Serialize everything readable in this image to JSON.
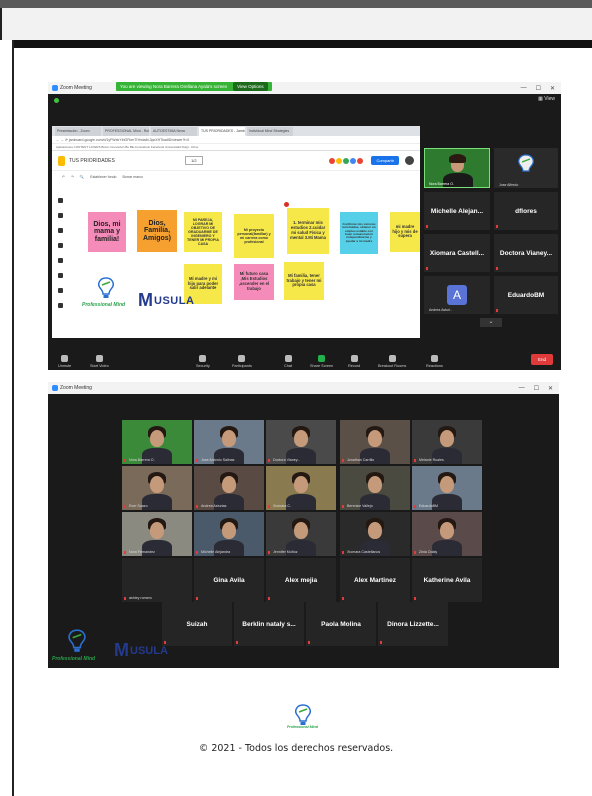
{
  "window1": {
    "title": "Zoom Meeting",
    "banner": "You are viewing Nora Barrera Orellana Ayala's screen",
    "view_options": "View Options",
    "view_label": "View",
    "browser": {
      "tabs": [
        "Presentación - Zoom",
        "PROFESSIONAL Mind - Ruta",
        "AUTOESTIMA Nena",
        "TUS PRIORIDADES - Jamboard",
        "Individual Mind Strategies"
      ],
      "url": "jamboard.google.com/d/1yFWxtrYbiGFbmTiYfwlaM-3pcXHTkadlD/viewer?f=0",
      "bookmarks": "Aplicaciones  CONTENT LAYERS  Boton Innovación  Bu  BE-Consultorio  Facebook  Universidad Rutgr..  Drive"
    },
    "jamboard": {
      "title": "TUS PRIORIDADES",
      "page_indicator": "1/2",
      "share_label": "Compartir",
      "tools": [
        "Establecer fondo",
        "Borrar marco"
      ]
    },
    "notes": [
      {
        "text": "Dios, mi mama y familia!",
        "color": "#f58bb8"
      },
      {
        "text": "Dios, Familia, Amigos)",
        "color": "#f6a030"
      },
      {
        "text": "MI PAREJA, LOGRAR MI OBJETIVO DE GRADUARME DE INGENIERO Y TENER MI PROPIA CASA",
        "color": "#f7e84a"
      },
      {
        "text": "Mi proyecto personal(familiar) y mi carrera como profesional",
        "color": "#f7e84a"
      },
      {
        "text": "1. terminar mis estudios 2.cuidar mi salud Física y mental 3.Mi Mama",
        "color": "#f7e84a"
      },
      {
        "text": "Confirmar mis carreras terminadas, obtener un empleo estable con buen remuneración independizarme y ayudar a mi madre",
        "color": "#56d0e8"
      },
      {
        "text": "mi madre hijo y mis de supera",
        "color": "#f7e84a"
      },
      {
        "text": "Mi madre y mi hijo para poder salir adelante",
        "color": "#f7e84a"
      },
      {
        "text": "Mi futuro casa ,Mis Estudios ,ascender en el trabajo",
        "color": "#f58bb8"
      },
      {
        "text": "Mi familia, tener trabajo y tener mi propia casa",
        "color": "#f7e84a"
      }
    ],
    "brand": {
      "tagline": "Professional Mind",
      "partner": "USULA"
    },
    "participants": [
      {
        "name": "Nora Barrera O.",
        "tile": "video"
      },
      {
        "name": "Jose Alfredo",
        "tile": "video"
      },
      {
        "name": "Michelle Alejan...",
        "tile": "name"
      },
      {
        "name": "dflores",
        "tile": "name"
      },
      {
        "name": "Xiomara Castell...",
        "tile": "name"
      },
      {
        "name": "Doctora Vianey...",
        "tile": "name"
      },
      {
        "name": "Andrea Asturi..",
        "tile": "avatar",
        "initial": "A"
      },
      {
        "name": "EduardoBM",
        "tile": "name"
      }
    ],
    "toolbar": [
      {
        "label": "Unmute",
        "icon": "mic-muted-icon"
      },
      {
        "label": "Start Video",
        "icon": "video-off-icon"
      },
      {
        "label": "Security",
        "icon": "shield-icon"
      },
      {
        "label": "Participants",
        "icon": "participants-icon",
        "count": "21"
      },
      {
        "label": "Chat",
        "icon": "chat-icon"
      },
      {
        "label": "Share Screen",
        "icon": "share-screen-icon"
      },
      {
        "label": "Record",
        "icon": "record-icon"
      },
      {
        "label": "Breakout Rooms",
        "icon": "breakout-icon"
      },
      {
        "label": "Reactions",
        "icon": "reactions-icon"
      }
    ],
    "end_label": "End"
  },
  "window2": {
    "title": "Zoom Meeting",
    "gallery": [
      {
        "name": "Nora Barrera O.",
        "tile": "video",
        "tone": "#3a8a3a"
      },
      {
        "name": "Jose Antonio Salinas",
        "tile": "video",
        "tone": "#6b7a8a"
      },
      {
        "name": "Doctora Vianey...",
        "tile": "video",
        "tone": "#4a4a4a"
      },
      {
        "name": "Jonathan Carrillo",
        "tile": "video",
        "tone": "#5a5048"
      },
      {
        "name": "Melanie Ruales",
        "tile": "video",
        "tone": "#3a3a3a"
      },
      {
        "name": "Ever Suazo",
        "tile": "video",
        "tone": "#7a6a5a"
      },
      {
        "name": "Andrea Asturias",
        "tile": "video",
        "tone": "#5a4a44"
      },
      {
        "name": "Xiomara C.",
        "tile": "video",
        "tone": "#8a7a50"
      },
      {
        "name": "Berenice Vallejo",
        "tile": "video",
        "tone": "#4a4a40"
      },
      {
        "name": "EduardoBM",
        "tile": "video",
        "tone": "#6a7a8a"
      },
      {
        "name": "Nora Fernandez",
        "tile": "video",
        "tone": "#8a8a80"
      },
      {
        "name": "Michelle Alejandra",
        "tile": "video",
        "tone": "#4a5a6a"
      },
      {
        "name": "Jennifer Muñoz",
        "tile": "video",
        "tone": "#3a3a3a"
      },
      {
        "name": "Xiomara Castellanos",
        "tile": "video",
        "tone": "#2a2a2a"
      },
      {
        "name": "Zinia Odaly",
        "tile": "video",
        "tone": "#5a4a4a"
      },
      {
        "name": "ashley romero",
        "tile": "name",
        "label": ""
      },
      {
        "name": "",
        "tile": "name",
        "label": "Gina Avila"
      },
      {
        "name": "",
        "tile": "name",
        "label": "Alex mejia"
      },
      {
        "name": "",
        "tile": "name",
        "label": "Alex Martinez"
      },
      {
        "name": "",
        "tile": "name",
        "label": "Katherine Avila"
      },
      {
        "name": "",
        "tile": "name",
        "label": "Suizah"
      },
      {
        "name": "",
        "tile": "name",
        "label": "Berklin nataly s..."
      },
      {
        "name": "",
        "tile": "name",
        "label": "Paola Molina"
      },
      {
        "name": "",
        "tile": "name",
        "label": "Dinora Lizzette..."
      }
    ]
  },
  "footer": {
    "brand": "Professional Mind",
    "copyright": "© 2021 - Todos los derechos reservados."
  }
}
